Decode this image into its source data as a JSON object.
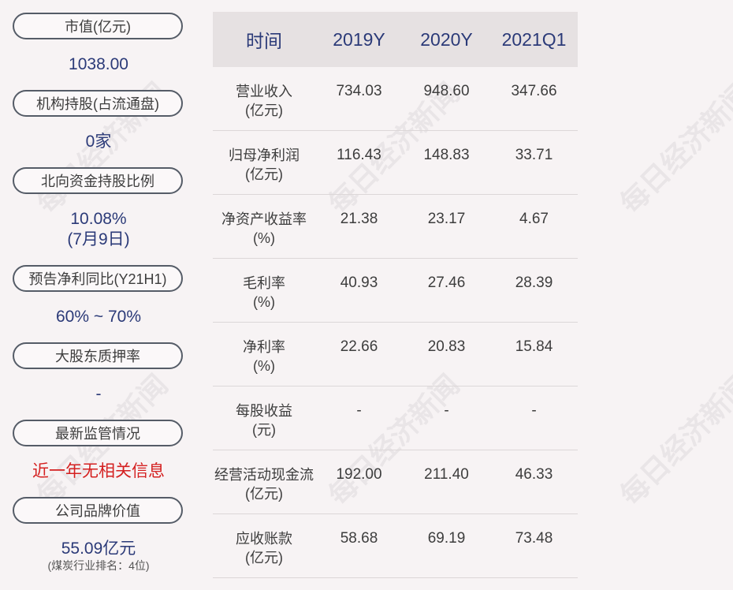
{
  "watermark": "每日经济新闻",
  "left_panel": {
    "items": [
      {
        "label": "市值(亿元)",
        "value": "1038.00"
      },
      {
        "label": "机构持股(占流通盘)",
        "value": "0家"
      },
      {
        "label": "北向资金持股比例",
        "value": "10.08%",
        "value2": "(7月9日)"
      },
      {
        "label": "预告净利同比(Y21H1)",
        "value": "60% ~ 70%"
      },
      {
        "label": "大股东质押率",
        "value": "-"
      },
      {
        "label": "最新监管情况",
        "value": "近一年无相关信息"
      },
      {
        "label": "公司品牌价值",
        "value": "55.09亿元",
        "note": "(煤炭行业排名：4位)"
      }
    ],
    "colors": {
      "value": "#2b3a78",
      "alert": "#d42020"
    }
  },
  "table": {
    "headers": [
      "时间",
      "2019Y",
      "2020Y",
      "2021Q1"
    ],
    "rows": [
      {
        "label": "营业收入",
        "unit": "(亿元)",
        "values": [
          "734.03",
          "948.60",
          "347.66"
        ]
      },
      {
        "label": "归母净利润",
        "unit": "(亿元)",
        "values": [
          "116.43",
          "148.83",
          "33.71"
        ]
      },
      {
        "label": "净资产收益率",
        "unit": "(%)",
        "values": [
          "21.38",
          "23.17",
          "4.67"
        ]
      },
      {
        "label": "毛利率",
        "unit": "(%)",
        "values": [
          "40.93",
          "27.46",
          "28.39"
        ]
      },
      {
        "label": "净利率",
        "unit": "(%)",
        "values": [
          "22.66",
          "20.83",
          "15.84"
        ]
      },
      {
        "label": "每股收益",
        "unit": "(元)",
        "values": [
          "-",
          "-",
          "-"
        ]
      },
      {
        "label": "经营活动现金流",
        "unit": "(亿元)",
        "values": [
          "192.00",
          "211.40",
          "46.33"
        ]
      },
      {
        "label": "应收账款",
        "unit": "(亿元)",
        "values": [
          "58.68",
          "69.19",
          "73.48"
        ]
      }
    ]
  }
}
